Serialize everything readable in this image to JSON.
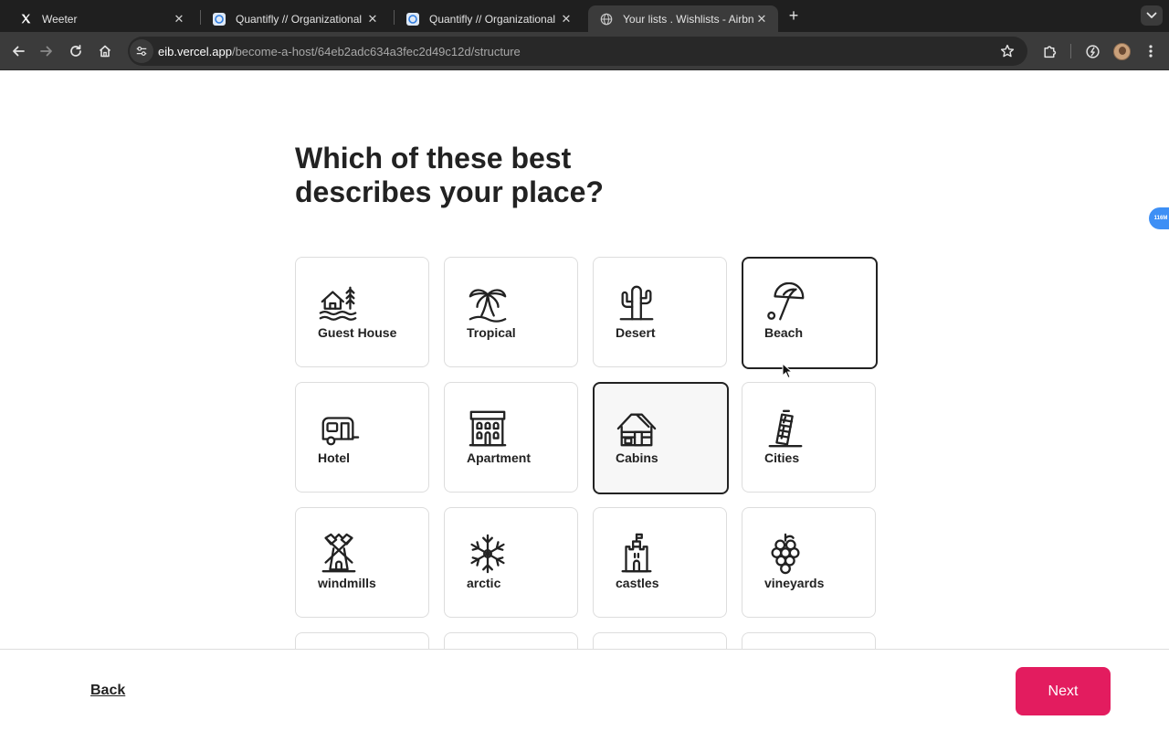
{
  "browser": {
    "tabs": [
      {
        "title": "Weeter",
        "favicon": "x-logo-icon"
      },
      {
        "title": "Quantifly // Organizational Dia",
        "favicon": "quantifly-icon"
      },
      {
        "title": "Quantifly // Organizational Dia",
        "favicon": "quantifly-icon"
      },
      {
        "title": "Your lists . Wishlists - Airbnb",
        "favicon": "globe-icon",
        "active": true
      }
    ],
    "url_host": "eib.vercel.app",
    "url_path": "/become-a-host/64eb2adc634a3fec2d49c12d/structure"
  },
  "page": {
    "heading": "Which of these best describes your place?",
    "categories": [
      {
        "label": "Guest House",
        "icon": "guest-house-icon"
      },
      {
        "label": "Tropical",
        "icon": "palm-tree-icon"
      },
      {
        "label": "Desert",
        "icon": "cactus-icon"
      },
      {
        "label": "Beach",
        "icon": "beach-umbrella-icon",
        "state": "hover"
      },
      {
        "label": "Hotel",
        "icon": "camper-trailer-icon"
      },
      {
        "label": "Apartment",
        "icon": "apartment-building-icon"
      },
      {
        "label": "Cabins",
        "icon": "cabin-icon",
        "state": "selected"
      },
      {
        "label": "Cities",
        "icon": "leaning-tower-icon"
      },
      {
        "label": "windmills",
        "icon": "windmill-icon"
      },
      {
        "label": "arctic",
        "icon": "snowflake-icon"
      },
      {
        "label": "castles",
        "icon": "castle-icon"
      },
      {
        "label": "vineyards",
        "icon": "grapes-icon"
      }
    ],
    "extension_badge": "116M"
  },
  "footer": {
    "back_label": "Back",
    "next_label": "Next"
  },
  "colors": {
    "accent": "#e31c5f",
    "text": "#222222",
    "card_border": "#dddddd"
  }
}
